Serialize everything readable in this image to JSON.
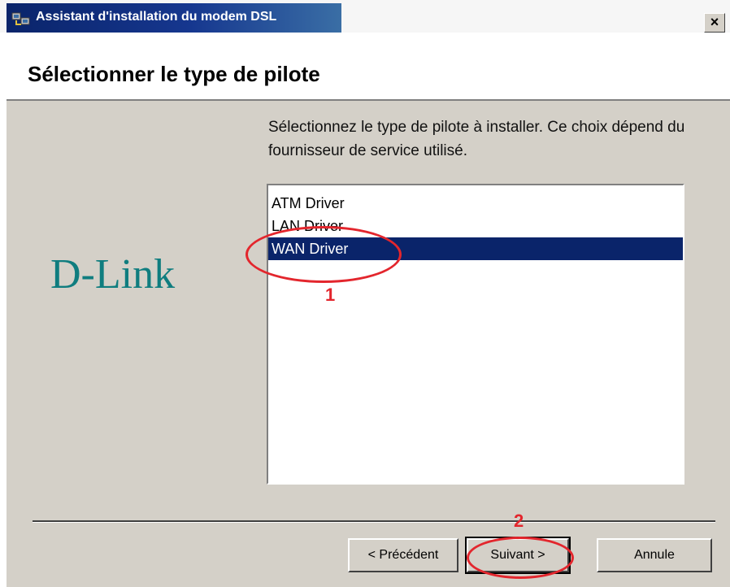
{
  "window": {
    "title": "Assistant d'installation du modem DSL",
    "close_label": "×"
  },
  "header": {
    "title": "Sélectionner le type de pilote"
  },
  "brand": {
    "logo_text": "D-Link",
    "color": "#0f7d7f"
  },
  "content": {
    "instruction": "Sélectionnez le type de pilote à installer. Ce choix dépend du fournisseur de service utilisé."
  },
  "driver_list": {
    "items": [
      "ATM Driver",
      "LAN Driver",
      "WAN Driver"
    ],
    "selected_index": 2
  },
  "buttons": {
    "back": "< Précédent",
    "next": "Suivant >",
    "cancel": "Annule"
  },
  "annotations": {
    "step1": "1",
    "step2": "2",
    "color": "#e3262d"
  }
}
